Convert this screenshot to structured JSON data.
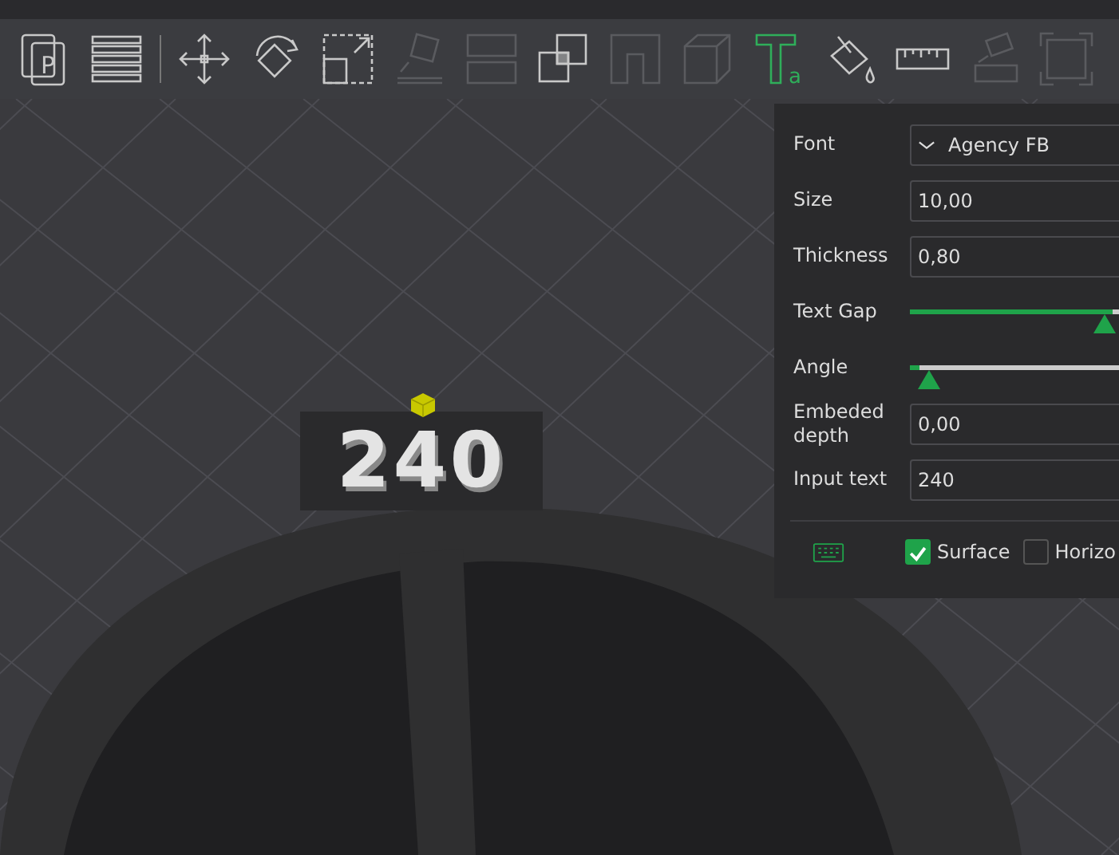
{
  "toolbar": {
    "tools": [
      {
        "kind": "pages",
        "label": "P",
        "disabled": false,
        "selected": false
      },
      {
        "kind": "list",
        "disabled": false,
        "selected": false
      },
      {
        "kind": "separator"
      },
      {
        "kind": "move",
        "disabled": false,
        "selected": false
      },
      {
        "kind": "rotate",
        "disabled": false,
        "selected": false
      },
      {
        "kind": "scale",
        "disabled": false,
        "selected": false
      },
      {
        "kind": "layflat",
        "disabled": true,
        "selected": false
      },
      {
        "kind": "split",
        "disabled": true,
        "selected": false
      },
      {
        "kind": "boolean",
        "disabled": false,
        "selected": false
      },
      {
        "kind": "hollow",
        "disabled": true,
        "selected": false
      },
      {
        "kind": "cube",
        "disabled": true,
        "selected": false
      },
      {
        "kind": "text",
        "label": "a",
        "disabled": false,
        "selected": true
      },
      {
        "kind": "paint",
        "disabled": false,
        "selected": false
      },
      {
        "kind": "ruler",
        "disabled": false,
        "selected": false
      },
      {
        "kind": "support",
        "disabled": true,
        "selected": false
      },
      {
        "kind": "corner",
        "disabled": true,
        "selected": false
      }
    ]
  },
  "scene": {
    "embossed_text": "240"
  },
  "panel": {
    "rows": [
      {
        "kind": "dropdown",
        "label": "Font",
        "value": "Agency FB"
      },
      {
        "kind": "input",
        "label": "Size",
        "value": "10,00"
      },
      {
        "kind": "input",
        "label": "Thickness",
        "value": "0,80"
      },
      {
        "kind": "slider",
        "label": "Text Gap",
        "level": 0.91
      },
      {
        "kind": "slider",
        "label": "Angle",
        "level": 0.04
      },
      {
        "kind": "input",
        "label": "Embeded depth",
        "value": "0,00"
      },
      {
        "kind": "input",
        "label": "Input text",
        "value": "240"
      }
    ],
    "options": [
      {
        "label": "Surface",
        "checked": true
      },
      {
        "label": "Horizo",
        "checked": false
      }
    ]
  }
}
